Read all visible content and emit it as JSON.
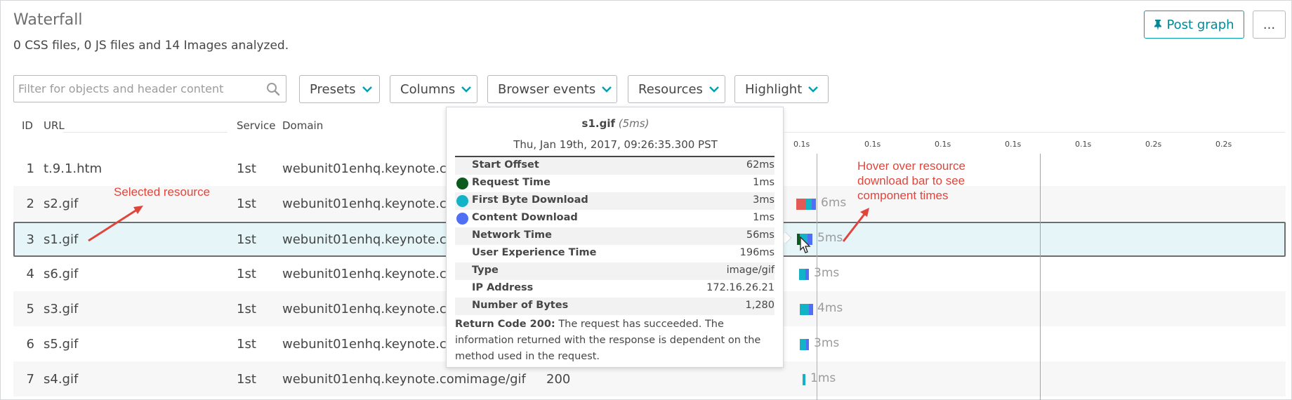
{
  "header": {
    "title": "Waterfall",
    "subtitle": "0 CSS files, 0 JS files and 14 Images analyzed.",
    "post_graph": "Post graph",
    "more": "..."
  },
  "toolbar": {
    "filter_placeholder": "Filter for objects and header content",
    "presets": "Presets",
    "columns": "Columns",
    "browser_events": "Browser events",
    "resources": "Resources",
    "highlight": "Highlight"
  },
  "table": {
    "columns": {
      "id": "ID",
      "url": "URL",
      "service": "Service",
      "domain": "Domain"
    },
    "axis_ticks": [
      "0.1s",
      "0.1s",
      "0.1s",
      "0.1s",
      "0.1s",
      "0.2s",
      "0.2s"
    ],
    "rows": [
      {
        "id": "1",
        "url": "t.9.1.htm",
        "service": "1st",
        "domain": "webunit01enhq.keynote.com",
        "type": "",
        "code": "",
        "time_label": ""
      },
      {
        "id": "2",
        "url": "s2.gif",
        "service": "1st",
        "domain": "webunit01enhq.keynote.com",
        "type": "",
        "code": "",
        "time_label": "6ms"
      },
      {
        "id": "3",
        "url": "s1.gif",
        "service": "1st",
        "domain": "webunit01enhq.keynote.com",
        "type": "",
        "code": "",
        "time_label": "5ms"
      },
      {
        "id": "4",
        "url": "s6.gif",
        "service": "1st",
        "domain": "webunit01enhq.keynote.com",
        "type": "",
        "code": "",
        "time_label": "3ms"
      },
      {
        "id": "5",
        "url": "s3.gif",
        "service": "1st",
        "domain": "webunit01enhq.keynote.com",
        "type": "",
        "code": "",
        "time_label": "4ms"
      },
      {
        "id": "6",
        "url": "s5.gif",
        "service": "1st",
        "domain": "webunit01enhq.keynote.com",
        "type": "",
        "code": "",
        "time_label": "3ms"
      },
      {
        "id": "7",
        "url": "s4.gif",
        "service": "1st",
        "domain": "webunit01enhq.keynote.com",
        "type": "image/gif",
        "code": "200",
        "time_label": "1ms"
      }
    ]
  },
  "tooltip": {
    "file": "s1.gif",
    "duration": "(5ms)",
    "date": "Thu, Jan 19th, 2017, 09:26:35.300 PST",
    "rows": [
      {
        "label": "Start Offset",
        "value": "62ms",
        "dot": ""
      },
      {
        "label": "Request Time",
        "value": "1ms",
        "dot": "#0b5a1e"
      },
      {
        "label": "First Byte Download",
        "value": "3ms",
        "dot": "#12b3c6"
      },
      {
        "label": "Content Download",
        "value": "1ms",
        "dot": "#4f6ff5"
      },
      {
        "label": "Network Time",
        "value": "56ms",
        "dot": ""
      },
      {
        "label": "User Experience Time",
        "value": "196ms",
        "dot": ""
      },
      {
        "label": "Type",
        "value": "image/gif",
        "dot": ""
      },
      {
        "label": "IP Address",
        "value": "172.16.26.21",
        "dot": ""
      },
      {
        "label": "Number of Bytes",
        "value": "1,280",
        "dot": ""
      }
    ],
    "note_bold": "Return Code 200:",
    "note_text": " The request has succeeded. The information returned with the response is dependent on the method used in the request."
  },
  "annotations": {
    "selected": "Selected resource",
    "hover_line1": "Hover over resource",
    "hover_line2": "download bar to see",
    "hover_line3": "component times"
  },
  "colors": {
    "accent": "#00a1b2",
    "request": "#0b5a1e",
    "first_byte": "#12b3c6",
    "content": "#4f6ff5",
    "dns": "#e35a55",
    "annotation": "#e0453c",
    "orange_line": "#f5a623",
    "green_line": "#5ed35e"
  }
}
